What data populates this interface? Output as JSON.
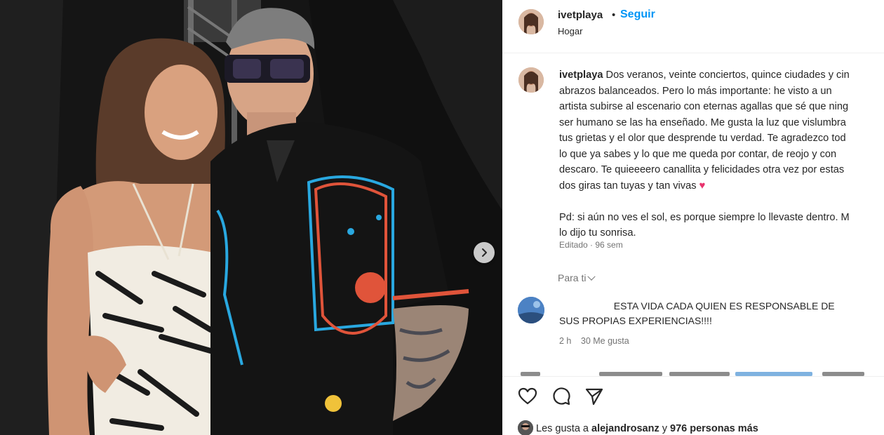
{
  "post": {
    "photo_alt": "",
    "next_button": "chevron-right-icon"
  },
  "header": {
    "username": "ivetplaya",
    "separator": "•",
    "follow_label": "Seguir",
    "location": "Hogar"
  },
  "caption": {
    "username": "ivetplaya",
    "lines": [
      " Dos veranos, veinte conciertos, quince ciudades y cin",
      "abrazos balanceados. Pero lo más importante: he visto a un",
      "artista subirse al escenario con eternas agallas que sé que ning",
      "ser humano se las ha enseñado. Me gusta la luz que vislumbra",
      "tus grietas y el olor que desprende tu verdad. Te agradezco tod",
      "lo que ya sabes y lo que me queda por contar, de reojo y con",
      "descaro. Te quieeeero canallita y felicidades otra vez por estas",
      "dos giras tan tuyas y tan vivas "
    ],
    "emoji": "♥",
    "ps_lines": [
      "Pd: si aún no ves el sol, es porque siempre lo llevaste dentro. M",
      "lo dijo tu sonrisa."
    ],
    "edited": "Editado · 96 sem"
  },
  "for_you": {
    "label": "Para ti"
  },
  "comment": {
    "lines": [
      "                    ESTA VIDA CADA QUIEN ES RESPONSABLE DE",
      "SUS PROPIAS EXPERIENCIAS!!!!"
    ],
    "time": "2 h",
    "likes": "30 Me gusta"
  },
  "actions": {
    "like_icon": "heart-icon",
    "comment_icon": "comment-icon",
    "share_icon": "send-icon"
  },
  "likes_line": {
    "prefix": "Les gusta a ",
    "user": "alejandrosanz",
    "middle": " y ",
    "count": "976 personas más"
  },
  "colors": {
    "accent": "#0095f6",
    "muted": "#737373",
    "text": "#262626",
    "emoji": "#e8336d"
  }
}
